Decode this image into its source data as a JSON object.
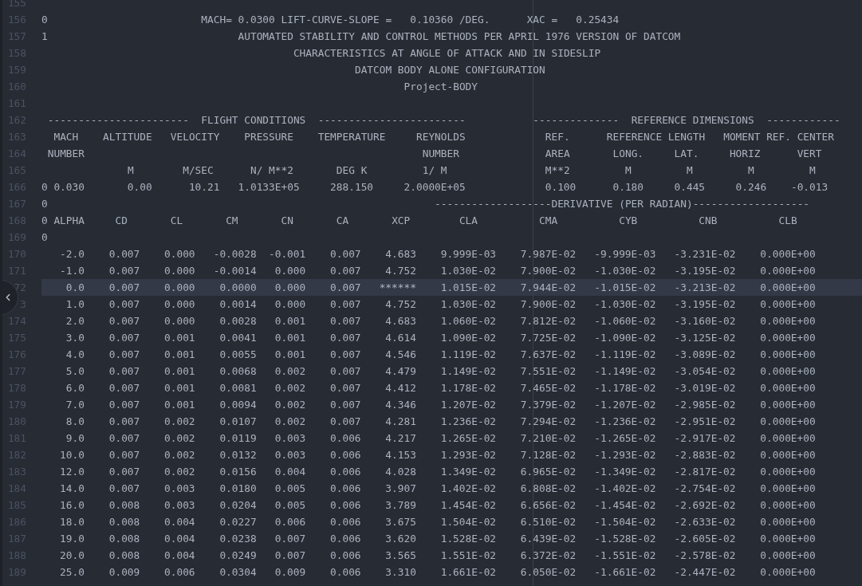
{
  "editor": {
    "lines": [
      {
        "number": "155",
        "kind": "blank",
        "highlighted": false
      },
      {
        "number": "156",
        "kind": "text",
        "highlighted": false,
        "text": "0                         MACH= 0.0300 LIFT-CURVE-SLOPE =   0.10360 /DEG.      XAC =   0.25434"
      },
      {
        "number": "157",
        "kind": "text",
        "highlighted": false,
        "text": "1                               AUTOMATED STABILITY AND CONTROL METHODS PER APRIL 1976 VERSION OF DATCOM"
      },
      {
        "number": "158",
        "kind": "text",
        "highlighted": false,
        "text": "                                         CHARACTERISTICS AT ANGLE OF ATTACK AND IN SIDESLIP"
      },
      {
        "number": "159",
        "kind": "text",
        "highlighted": false,
        "text": "                                                   DATCOM BODY ALONE CONFIGURATION"
      },
      {
        "number": "160",
        "kind": "text",
        "highlighted": false,
        "text": "                                                           Project-BODY"
      },
      {
        "number": "161",
        "kind": "blank",
        "highlighted": false
      },
      {
        "number": "162",
        "kind": "text",
        "highlighted": false,
        "text": " -----------------------  FLIGHT CONDITIONS  ------------------------           --------------  REFERENCE DIMENSIONS  ------------"
      },
      {
        "number": "163",
        "kind": "text",
        "highlighted": false,
        "text": "  MACH    ALTITUDE   VELOCITY    PRESSURE    TEMPERATURE     REYNOLDS             REF.      REFERENCE LENGTH   MOMENT REF. CENTER"
      },
      {
        "number": "164",
        "kind": "text",
        "highlighted": false,
        "text": " NUMBER                                                       NUMBER              AREA       LONG.     LAT.     HORIZ      VERT"
      },
      {
        "number": "165",
        "kind": "text",
        "highlighted": false,
        "text": "              M        M/SEC      N/ M**2       DEG K         1/ M                M**2         M         M         M         M"
      },
      {
        "number": "166",
        "kind": "text",
        "highlighted": false,
        "text": "0 0.030       0.00      10.21   1.0133E+05     288.150     2.0000E+05             0.100      0.180     0.445     0.246    -0.013"
      },
      {
        "number": "167",
        "kind": "text",
        "highlighted": false,
        "text": "0                                                               -------------------DERIVATIVE (PER RADIAN)-------------------"
      },
      {
        "number": "168",
        "kind": "text",
        "highlighted": false,
        "text": "0 ALPHA     CD       CL       CM       CN       CA       XCP        CLA          CMA          CYB          CNB          CLB"
      },
      {
        "number": "169",
        "kind": "text",
        "highlighted": false,
        "text": "0"
      },
      {
        "number": "170",
        "kind": "row",
        "highlighted": false,
        "cells": [
          "-2.0",
          "0.007",
          "0.000",
          "-0.0028",
          "-0.001",
          "0.007",
          "4.683",
          "9.999E-03",
          "7.987E-02",
          "-9.999E-03",
          "-3.231E-02",
          "0.000E+00"
        ]
      },
      {
        "number": "171",
        "kind": "row",
        "highlighted": false,
        "cells": [
          "-1.0",
          "0.007",
          "0.000",
          "-0.0014",
          "0.000",
          "0.007",
          "4.752",
          "1.030E-02",
          "7.900E-02",
          "-1.030E-02",
          "-3.195E-02",
          "0.000E+00"
        ]
      },
      {
        "number": "72",
        "kind": "row",
        "highlighted": true,
        "cells": [
          "0.0",
          "0.007",
          "0.000",
          "0.0000",
          "0.000",
          "0.007",
          "******",
          "1.015E-02",
          "7.944E-02",
          "-1.015E-02",
          "-3.213E-02",
          "0.000E+00"
        ]
      },
      {
        "number": "3",
        "kind": "row",
        "highlighted": false,
        "cells": [
          "1.0",
          "0.007",
          "0.000",
          "0.0014",
          "0.000",
          "0.007",
          "4.752",
          "1.030E-02",
          "7.900E-02",
          "-1.030E-02",
          "-3.195E-02",
          "0.000E+00"
        ]
      },
      {
        "number": "174",
        "kind": "row",
        "highlighted": false,
        "cells": [
          "2.0",
          "0.007",
          "0.000",
          "0.0028",
          "0.001",
          "0.007",
          "4.683",
          "1.060E-02",
          "7.812E-02",
          "-1.060E-02",
          "-3.160E-02",
          "0.000E+00"
        ]
      },
      {
        "number": "175",
        "kind": "row",
        "highlighted": false,
        "cells": [
          "3.0",
          "0.007",
          "0.001",
          "0.0041",
          "0.001",
          "0.007",
          "4.614",
          "1.090E-02",
          "7.725E-02",
          "-1.090E-02",
          "-3.125E-02",
          "0.000E+00"
        ]
      },
      {
        "number": "176",
        "kind": "row",
        "highlighted": false,
        "cells": [
          "4.0",
          "0.007",
          "0.001",
          "0.0055",
          "0.001",
          "0.007",
          "4.546",
          "1.119E-02",
          "7.637E-02",
          "-1.119E-02",
          "-3.089E-02",
          "0.000E+00"
        ]
      },
      {
        "number": "177",
        "kind": "row",
        "highlighted": false,
        "cells": [
          "5.0",
          "0.007",
          "0.001",
          "0.0068",
          "0.002",
          "0.007",
          "4.479",
          "1.149E-02",
          "7.551E-02",
          "-1.149E-02",
          "-3.054E-02",
          "0.000E+00"
        ]
      },
      {
        "number": "178",
        "kind": "row",
        "highlighted": false,
        "cells": [
          "6.0",
          "0.007",
          "0.001",
          "0.0081",
          "0.002",
          "0.007",
          "4.412",
          "1.178E-02",
          "7.465E-02",
          "-1.178E-02",
          "-3.019E-02",
          "0.000E+00"
        ]
      },
      {
        "number": "179",
        "kind": "row",
        "highlighted": false,
        "cells": [
          "7.0",
          "0.007",
          "0.001",
          "0.0094",
          "0.002",
          "0.007",
          "4.346",
          "1.207E-02",
          "7.379E-02",
          "-1.207E-02",
          "-2.985E-02",
          "0.000E+00"
        ]
      },
      {
        "number": "180",
        "kind": "row",
        "highlighted": false,
        "cells": [
          "8.0",
          "0.007",
          "0.002",
          "0.0107",
          "0.002",
          "0.007",
          "4.281",
          "1.236E-02",
          "7.294E-02",
          "-1.236E-02",
          "-2.951E-02",
          "0.000E+00"
        ]
      },
      {
        "number": "181",
        "kind": "row",
        "highlighted": false,
        "cells": [
          "9.0",
          "0.007",
          "0.002",
          "0.0119",
          "0.003",
          "0.006",
          "4.217",
          "1.265E-02",
          "7.210E-02",
          "-1.265E-02",
          "-2.917E-02",
          "0.000E+00"
        ]
      },
      {
        "number": "182",
        "kind": "row",
        "highlighted": false,
        "cells": [
          "10.0",
          "0.007",
          "0.002",
          "0.0132",
          "0.003",
          "0.006",
          "4.153",
          "1.293E-02",
          "7.128E-02",
          "-1.293E-02",
          "-2.883E-02",
          "0.000E+00"
        ]
      },
      {
        "number": "183",
        "kind": "row",
        "highlighted": false,
        "cells": [
          "12.0",
          "0.007",
          "0.002",
          "0.0156",
          "0.004",
          "0.006",
          "4.028",
          "1.349E-02",
          "6.965E-02",
          "-1.349E-02",
          "-2.817E-02",
          "0.000E+00"
        ]
      },
      {
        "number": "184",
        "kind": "row",
        "highlighted": false,
        "cells": [
          "14.0",
          "0.007",
          "0.003",
          "0.0180",
          "0.005",
          "0.006",
          "3.907",
          "1.402E-02",
          "6.808E-02",
          "-1.402E-02",
          "-2.754E-02",
          "0.000E+00"
        ]
      },
      {
        "number": "185",
        "kind": "row",
        "highlighted": false,
        "cells": [
          "16.0",
          "0.008",
          "0.003",
          "0.0204",
          "0.005",
          "0.006",
          "3.789",
          "1.454E-02",
          "6.656E-02",
          "-1.454E-02",
          "-2.692E-02",
          "0.000E+00"
        ]
      },
      {
        "number": "186",
        "kind": "row",
        "highlighted": false,
        "cells": [
          "18.0",
          "0.008",
          "0.004",
          "0.0227",
          "0.006",
          "0.006",
          "3.675",
          "1.504E-02",
          "6.510E-02",
          "-1.504E-02",
          "-2.633E-02",
          "0.000E+00"
        ]
      },
      {
        "number": "187",
        "kind": "row",
        "highlighted": false,
        "cells": [
          "19.0",
          "0.008",
          "0.004",
          "0.0238",
          "0.007",
          "0.006",
          "3.620",
          "1.528E-02",
          "6.439E-02",
          "-1.528E-02",
          "-2.605E-02",
          "0.000E+00"
        ]
      },
      {
        "number": "188",
        "kind": "row",
        "highlighted": false,
        "cells": [
          "20.0",
          "0.008",
          "0.004",
          "0.0249",
          "0.007",
          "0.006",
          "3.565",
          "1.551E-02",
          "6.372E-02",
          "-1.551E-02",
          "-2.578E-02",
          "0.000E+00"
        ]
      },
      {
        "number": "189",
        "kind": "row",
        "highlighted": false,
        "cells": [
          "25.0",
          "0.009",
          "0.006",
          "0.0304",
          "0.009",
          "0.006",
          "3.310",
          "1.661E-02",
          "6.050E-02",
          "-1.661E-02",
          "-2.447E-02",
          "0.000E+00"
        ]
      }
    ]
  }
}
